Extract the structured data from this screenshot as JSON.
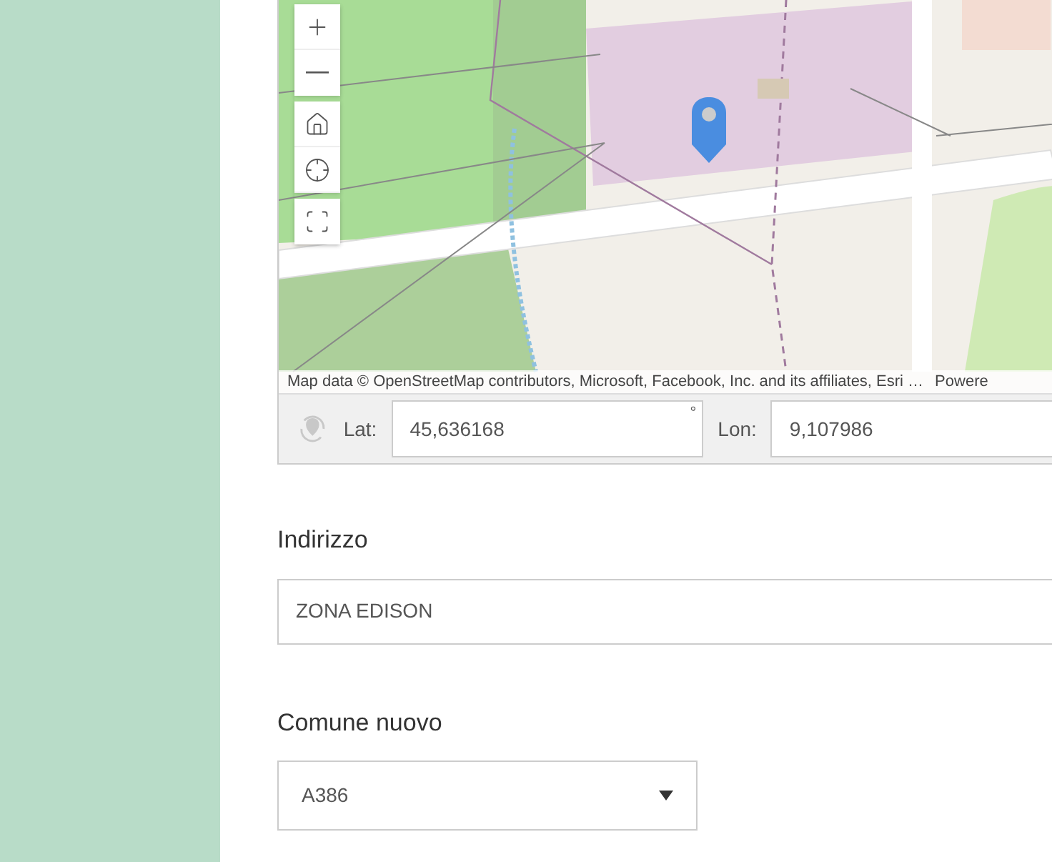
{
  "map": {
    "attribution": "Map data © OpenStreetMap contributors, Microsoft, Facebook, Inc. and its affiliates, Esri …",
    "attribution_suffix": "Powere"
  },
  "coordinates": {
    "lat_label": "Lat:",
    "lat_value": "45,636168",
    "degree_mark": "°",
    "lon_label": "Lon:",
    "lon_value": "9,107986"
  },
  "address": {
    "label": "Indirizzo",
    "value": "ZONA EDISON"
  },
  "municipality": {
    "label": "Comune nuovo",
    "value": "A386"
  }
}
